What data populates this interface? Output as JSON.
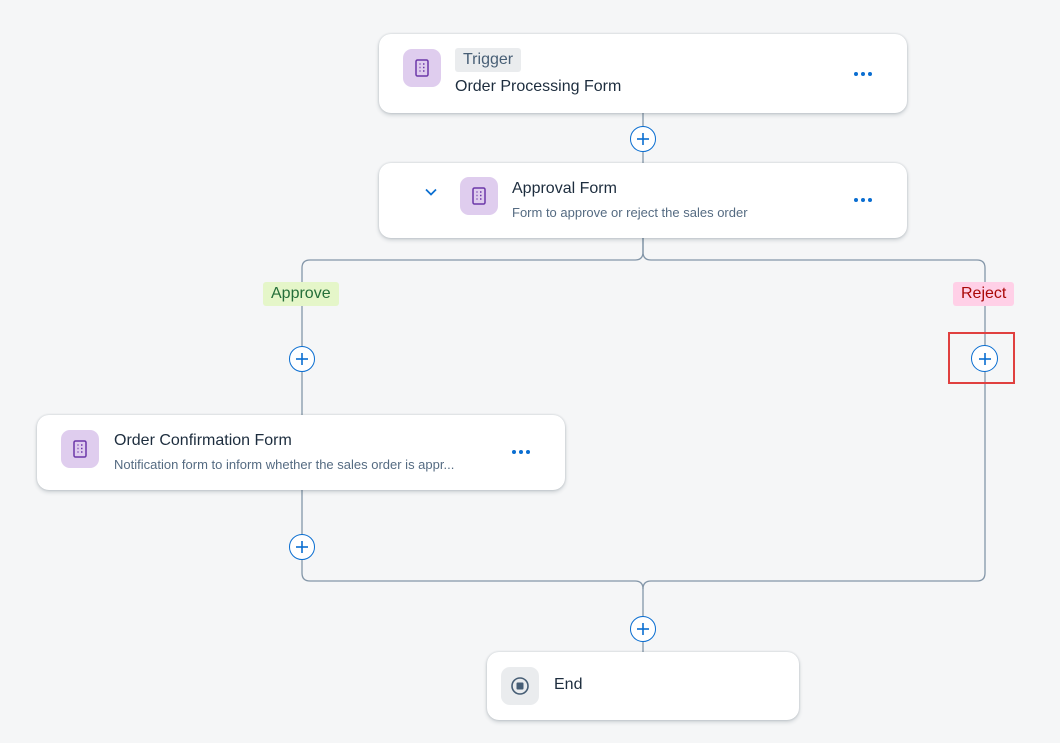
{
  "trigger_card": {
    "tag": "Trigger",
    "title": "Order Processing Form",
    "icon": "form-icon",
    "more_icon": "more-icon"
  },
  "approval_card": {
    "title": "Approval Form",
    "subtitle": "Form to approve or reject the sales order",
    "icon": "form-icon",
    "expand_icon": "chevron-down-icon",
    "more_icon": "more-icon"
  },
  "branches": {
    "approve_label": "Approve",
    "reject_label": "Reject"
  },
  "confirmation_card": {
    "title": "Order Confirmation Form",
    "subtitle": "Notification form to inform whether the sales order is appr...",
    "icon": "form-icon",
    "more_icon": "more-icon"
  },
  "end_card": {
    "title": "End",
    "icon": "stop-icon"
  },
  "colors": {
    "background": "#f5f6f7",
    "accent": "#0a6ed1",
    "connector": "#8396a8",
    "form_icon_tile": "#dfcdee",
    "form_icon": "#6b37a8",
    "approve_bg": "#e5f6c9",
    "approve_text": "#256f3a",
    "reject_bg": "#ffd0e7",
    "reject_text": "#aa0808",
    "trigger_tag_bg": "#eaecee",
    "highlight": "#e0403f"
  }
}
